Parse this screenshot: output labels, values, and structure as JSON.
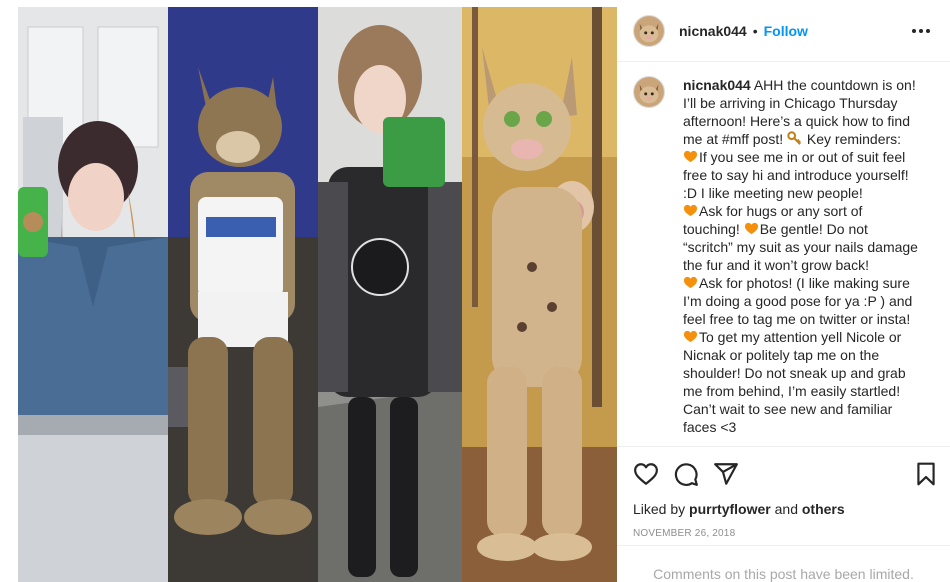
{
  "post": {
    "username": "nicnak044",
    "dot": "•",
    "follow_label": "Follow",
    "caption_lines": [
      {
        "user": "nicnak044",
        "text": " AHH the countdown is on!"
      },
      {
        "text": "I’ll be arriving in Chicago Thursday"
      },
      {
        "text": "afternoon! Here’s a quick how to find"
      },
      {
        "text": "me at #mff post!",
        "emoji_after": "key",
        "tail": " Key reminders:"
      },
      {
        "emoji_before": "heart",
        "text": "If you see me in or out of suit feel"
      },
      {
        "text": "free to say hi and introduce yourself!"
      },
      {
        "text": ":D I like meeting new people!"
      },
      {
        "emoji_before": "heart",
        "text": "Ask for hugs or any sort of"
      },
      {
        "text": "touching!",
        "emoji_after": "heart",
        "tail": "Be gentle! Do not"
      },
      {
        "text": "“scritch” my suit as your nails damage"
      },
      {
        "text": "the fur and it won’t grow back!"
      },
      {
        "emoji_before": "heart",
        "text": "Ask for photos! (I like making sure"
      },
      {
        "text": "I’m doing a good pose for ya :P ) and"
      },
      {
        "text": "feel free to tag me on twitter or insta!"
      },
      {
        "emoji_before": "heart",
        "text": "To get my attention yell Nicole or"
      },
      {
        "text": "Nicnak or politely tap me on the"
      },
      {
        "text": "shoulder! Do not sneak up and grab"
      },
      {
        "text": "me from behind, I’m easily startled!"
      },
      {
        "text": "Can’t wait to see new and familiar"
      },
      {
        "text": "faces <3"
      }
    ],
    "liked_by_prefix": "Liked by ",
    "liked_by_user": "purrtyflower",
    "liked_by_and": " and ",
    "liked_by_others": "others",
    "date": "NOVEMBER 26, 2018",
    "comments_limited": "Comments on this post have been limited."
  },
  "icons": {
    "more": "more-options-icon",
    "like": "heart-icon",
    "comment": "comment-icon",
    "share": "share-icon",
    "save": "bookmark-icon",
    "caption_emoji_heart": "orange-heart-emoji",
    "caption_emoji_key": "key-emoji"
  },
  "colors": {
    "link_blue": "#0095f6",
    "text": "#262626",
    "muted": "#8e8e8e",
    "heart_emoji": "#f4900c",
    "key_emoji": "#c1821a"
  }
}
